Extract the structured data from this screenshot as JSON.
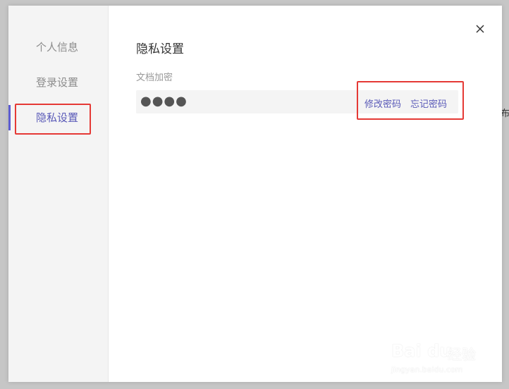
{
  "sidebar": {
    "items": [
      {
        "label": "个人信息",
        "active": false
      },
      {
        "label": "登录设置",
        "active": false
      },
      {
        "label": "隐私设置",
        "active": true
      }
    ]
  },
  "main": {
    "title": "隐私设置",
    "field_label": "文档加密",
    "password_mask": "●●●●",
    "actions": {
      "change_label": "修改密码",
      "forgot_label": "忘记密码"
    }
  },
  "background": {
    "edge_text": "布"
  },
  "watermark": {
    "brand": "Bai du",
    "suffix": "经验",
    "url": "jingyan.baidu.com"
  },
  "colors": {
    "accent": "#5a5ab8",
    "highlight": "#e53935",
    "sidebar_bg": "#f4f4f4"
  },
  "icons": {
    "close": "close-icon"
  }
}
